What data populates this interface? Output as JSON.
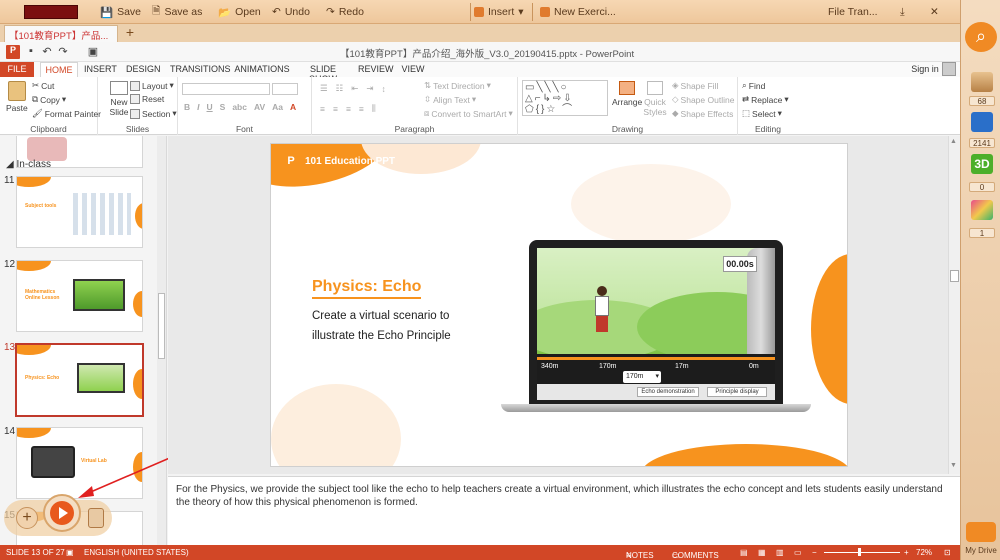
{
  "topbar": {
    "save": "Save",
    "save_as": "Save as",
    "open": "Open",
    "undo": "Undo",
    "redo": "Redo",
    "insert": "Insert",
    "new_exercise": "New Exerci...",
    "file_transfer": "File Tran..."
  },
  "doc_tab": {
    "label": "【101教育PPT】产品..."
  },
  "window_title": "【101教育PPT】产品介绍_海外版_V3.0_20190415.pptx - PowerPoint",
  "ribbon_tabs": [
    "FILE",
    "HOME",
    "INSERT",
    "DESIGN",
    "TRANSITIONS",
    "ANIMATIONS",
    "SLIDE SHOW",
    "REVIEW",
    "VIEW"
  ],
  "sign_in": "Sign in",
  "ribbon": {
    "paste": "Paste",
    "cut": "Cut",
    "copy": "Copy",
    "format_painter": "Format Painter",
    "clipboard": "Clipboard",
    "new_slide": "New Slide",
    "layout": "Layout",
    "reset": "Reset",
    "section": "Section",
    "slides": "Slides",
    "font_group": "Font",
    "text_direction": "Text Direction",
    "align_text": "Align Text",
    "convert_smartart": "Convert to SmartArt",
    "paragraph": "Paragraph",
    "arrange": "Arrange",
    "quick_styles": "Quick Styles",
    "shape_fill": "Shape Fill",
    "shape_outline": "Shape Outline",
    "shape_effects": "Shape Effects",
    "drawing": "Drawing",
    "find": "Find",
    "replace": "Replace",
    "select": "Select",
    "editing": "Editing"
  },
  "slide_panel": {
    "section": "In-class",
    "thumbs": [
      {
        "num": "11",
        "title": "Subject tools"
      },
      {
        "num": "12",
        "title": "Mathematics Online Lesson"
      },
      {
        "num": "13",
        "title": "Physics: Echo"
      },
      {
        "num": "14",
        "title": "Virtual Lab"
      },
      {
        "num": "15",
        "title": ""
      }
    ]
  },
  "slide": {
    "logo_text": "101 Education PPT",
    "heading": "Physics: Echo",
    "body_line1": "Create a virtual scenario to",
    "body_line2": "illustrate the Echo Principle",
    "timer": "00.00s",
    "scale_labels": [
      "340m",
      "170m",
      "17m",
      "0m"
    ],
    "distance_value": "170m",
    "btn_echo": "Echo demonstration",
    "btn_principle": "Principle display"
  },
  "notes": "For the Physics, we provide the subject tool like the echo to help teachers create a virtual environment, which illustrates the echo concept and lets students easily understand the theory of how this physical phenomenon is formed.",
  "status": {
    "slide_count": "SLIDE 13 OF 27",
    "language": "ENGLISH (UNITED STATES)",
    "notes": "NOTES",
    "comments": "COMMENTS",
    "zoom": "72%"
  },
  "right_sidebar": {
    "badges": [
      "68",
      "2141",
      "0",
      "1"
    ],
    "my_drive": "My Drive"
  },
  "colors": {
    "accent": "#d24726",
    "slide_orange": "#f7931e",
    "topbar": "#f0cba3"
  }
}
